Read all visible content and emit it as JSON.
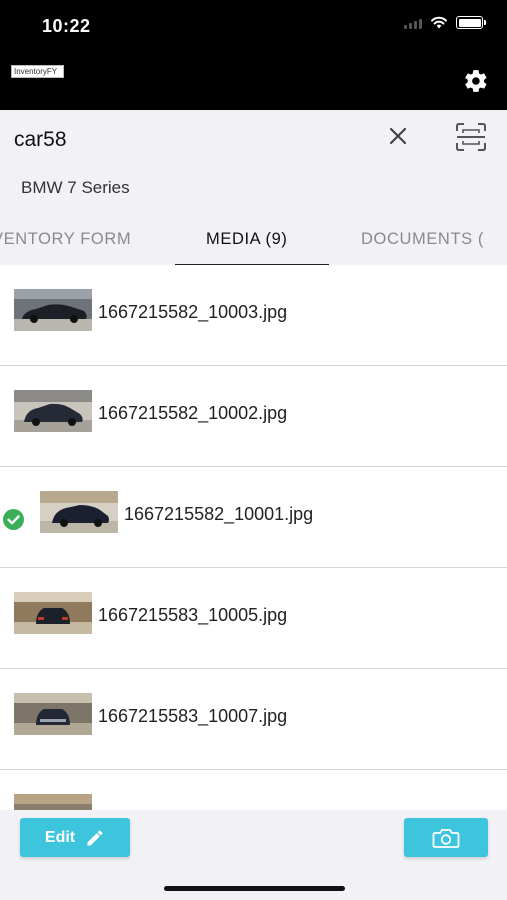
{
  "status_bar": {
    "time": "10:22"
  },
  "header": {
    "logo_text": "InventoryFY"
  },
  "search": {
    "value": "car58"
  },
  "vehicle": {
    "name": "BMW 7 Series"
  },
  "tabs": [
    {
      "label": "VENTORY FORM"
    },
    {
      "label": "MEDIA (9)"
    },
    {
      "label": "DOCUMENTS ("
    }
  ],
  "active_tab": 1,
  "media": [
    {
      "filename": "1667215582_10003.jpg",
      "selected": false
    },
    {
      "filename": "1667215582_10002.jpg",
      "selected": false
    },
    {
      "filename": "1667215582_10001.jpg",
      "selected": true
    },
    {
      "filename": "1667215583_10005.jpg",
      "selected": false
    },
    {
      "filename": "1667215583_10007.jpg",
      "selected": false
    },
    {
      "filename": "",
      "selected": false
    }
  ],
  "actions": {
    "edit_label": "Edit"
  },
  "icons": {
    "settings": "gear-icon",
    "clear": "close-icon",
    "scan": "scan-icon",
    "edit": "pencil-icon",
    "camera": "camera-icon",
    "selected": "check-circle-icon"
  },
  "colors": {
    "accent": "#3ec5de",
    "check": "#3bae5a",
    "header_bg": "#000000"
  }
}
